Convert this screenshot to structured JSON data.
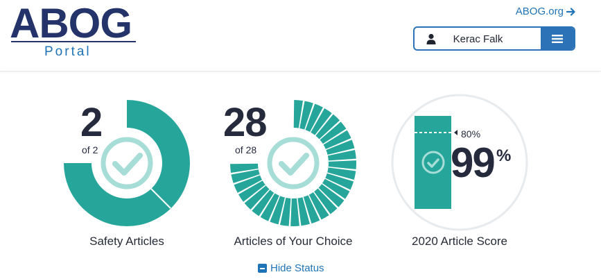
{
  "header": {
    "logo_text": "ABOG",
    "logo_subtext": "Portal",
    "external_link": "ABOG.org",
    "user_name": "Kerac Falk"
  },
  "status": {
    "safety": {
      "completed": "2",
      "of_total": "of 2",
      "label": "Safety Articles",
      "fraction": 1.0
    },
    "choice": {
      "completed": "28",
      "of_total": "of 28",
      "label": "Articles of Your Choice",
      "segments": 28,
      "fraction": 1.0
    },
    "score": {
      "value": "99",
      "percent_sign": "%",
      "target": "80%",
      "label": "2020 Article Score",
      "fraction": 0.99,
      "target_fraction": 0.8
    },
    "hide_label": "Hide Status"
  },
  "colors": {
    "brand_navy": "#25336b",
    "link_blue": "#1f73b7",
    "teal": "#26a69a",
    "teal_light": "#a7ddd7",
    "text_dark": "#252b3d"
  }
}
